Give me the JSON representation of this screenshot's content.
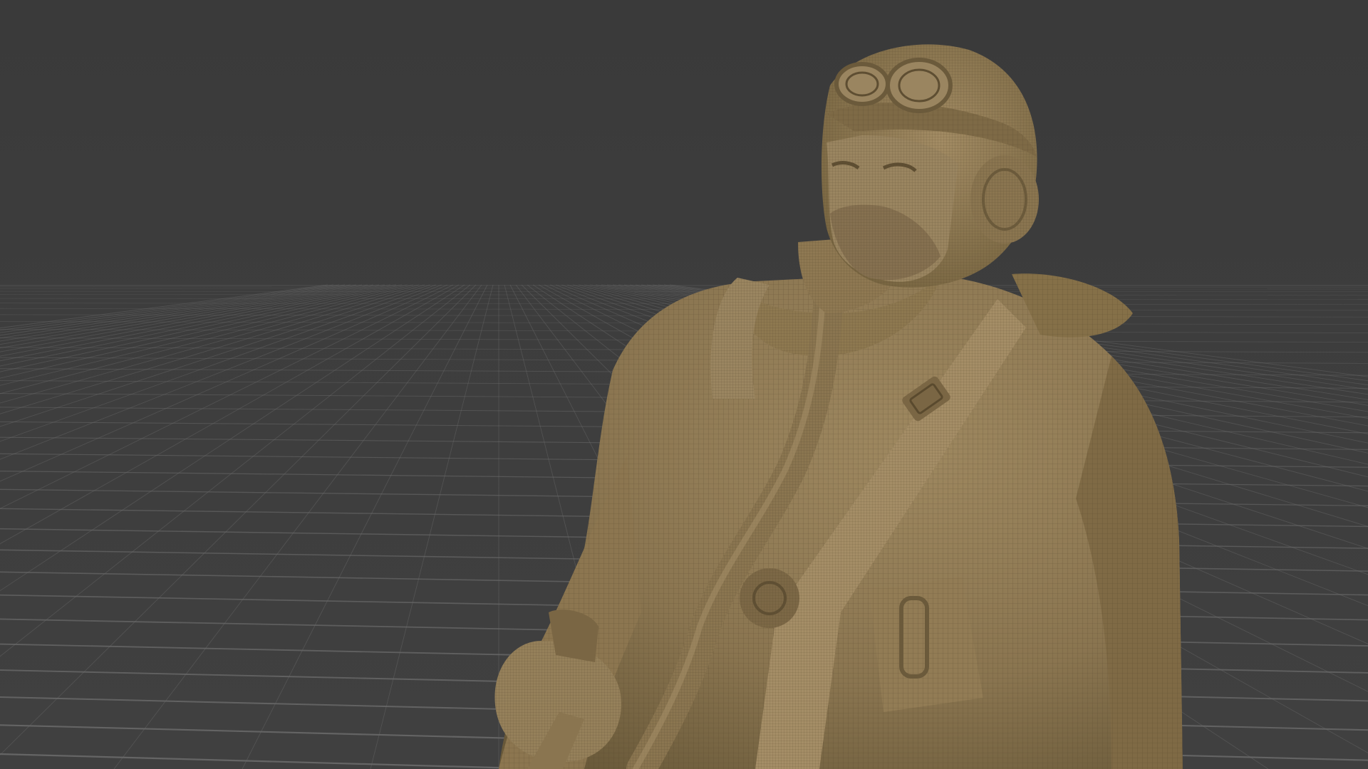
{
  "viewport": {
    "background_color": "#3d3d3d",
    "grid_color": "#6a6a6a",
    "model_color": "#8f7a52",
    "model_shade_color": "#6e5d3c",
    "model_highlight_color": "#a8916a",
    "wire_color": "#5a4a2e",
    "display_mode": "wireframe-on-shaded",
    "subject": "seated-pilot-sculpt"
  }
}
